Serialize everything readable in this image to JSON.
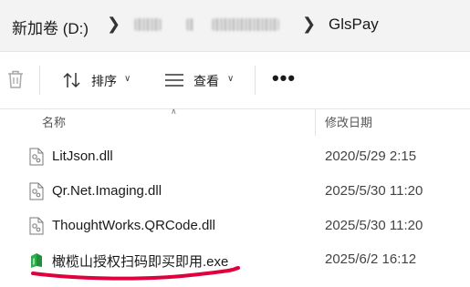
{
  "breadcrumb": {
    "drive": "新加卷 (D:)",
    "folder": "GlsPay",
    "redacted_1": "ppp",
    "redacted_2": "x",
    "redacted_3": "xxxxxxxx"
  },
  "toolbar": {
    "delete_icon": "trash-icon",
    "sort_label": "排序",
    "view_label": "查看",
    "more_label": "•••"
  },
  "columns": {
    "name": "名称",
    "date_modified": "修改日期"
  },
  "files": [
    {
      "name": "LitJson.dll",
      "date": "2020/5/29 2:15",
      "icon": "dll-file-icon"
    },
    {
      "name": "Qr.Net.Imaging.dll",
      "date": "2025/5/30 11:20",
      "icon": "dll-file-icon"
    },
    {
      "name": "ThoughtWorks.QRCode.dll",
      "date": "2025/5/30 11:20",
      "icon": "dll-file-icon"
    },
    {
      "name": "橄榄山授权扫码即买即用.exe",
      "date": "2025/6/2 16:12",
      "icon": "exe-app-icon"
    }
  ],
  "colors": {
    "annotation": "#e0003c",
    "exe_icon": "#2db04b"
  }
}
